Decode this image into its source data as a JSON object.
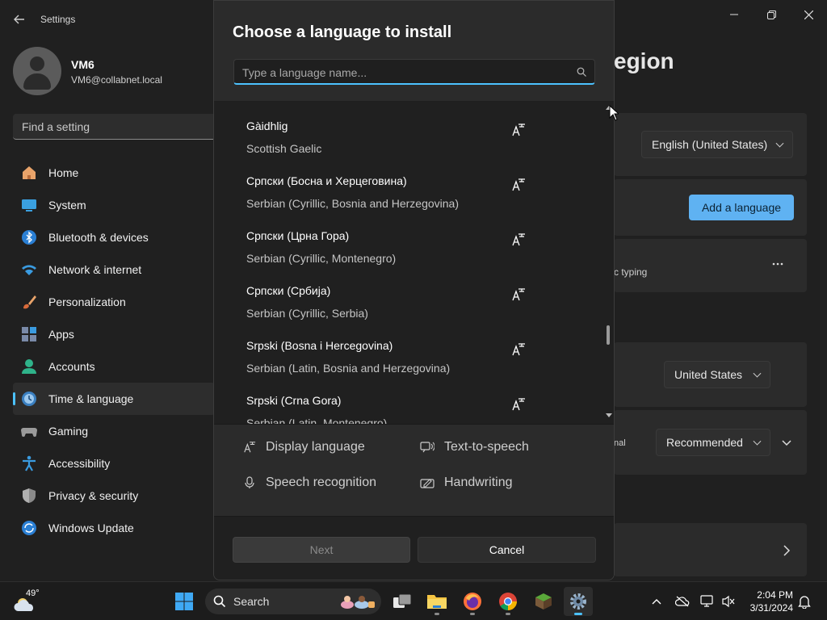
{
  "window": {
    "app_title": "Settings",
    "pane_title": "egion"
  },
  "profile": {
    "name": "VM6",
    "email": "VM6@collabnet.local"
  },
  "find_setting": {
    "placeholder": "Find a setting"
  },
  "sidebar": {
    "items": [
      {
        "label": "Home",
        "icon": "home-icon"
      },
      {
        "label": "System",
        "icon": "system-icon"
      },
      {
        "label": "Bluetooth & devices",
        "icon": "bluetooth-icon"
      },
      {
        "label": "Network & internet",
        "icon": "wifi-icon"
      },
      {
        "label": "Personalization",
        "icon": "brush-icon"
      },
      {
        "label": "Apps",
        "icon": "apps-icon"
      },
      {
        "label": "Accounts",
        "icon": "accounts-icon"
      },
      {
        "label": "Time & language",
        "icon": "clock-globe-icon",
        "active": true
      },
      {
        "label": "Gaming",
        "icon": "gamepad-icon"
      },
      {
        "label": "Accessibility",
        "icon": "accessibility-icon"
      },
      {
        "label": "Privacy & security",
        "icon": "shield-icon"
      },
      {
        "label": "Windows Update",
        "icon": "update-icon"
      }
    ]
  },
  "background": {
    "display_language_value": "English (United States)",
    "add_language_label": "Add a language",
    "typing_text": "c typing",
    "region_value": "United States",
    "regional_format_label": "nal",
    "regional_format_value": "Recommended"
  },
  "dialog": {
    "title": "Choose a language to install",
    "search_placeholder": "Type a language name...",
    "languages": [
      {
        "native": "Gàidhlig",
        "english": "Scottish Gaelic"
      },
      {
        "native": "Српски (Босна и Херцеговина)",
        "english": "Serbian (Cyrillic, Bosnia and Herzegovina)"
      },
      {
        "native": "Српски (Црна Гора)",
        "english": "Serbian (Cyrillic, Montenegro)"
      },
      {
        "native": "Српски (Србија)",
        "english": "Serbian (Cyrillic, Serbia)"
      },
      {
        "native": "Srpski (Bosna i Hercegovina)",
        "english": "Serbian (Latin, Bosnia and Herzegovina)"
      },
      {
        "native": "Srpski (Crna Gora)",
        "english": "Serbian (Latin, Montenegro)"
      }
    ],
    "legend": {
      "display_language": "Display language",
      "text_to_speech": "Text-to-speech",
      "speech_recognition": "Speech recognition",
      "handwriting": "Handwriting"
    },
    "next_label": "Next",
    "cancel_label": "Cancel"
  },
  "taskbar": {
    "weather_temp": "49°",
    "search_label": "Search",
    "time": "2:04 PM",
    "date": "3/31/2024"
  },
  "colors": {
    "accent": "#4cc2ff",
    "background": "#202020",
    "dialog": "#2b2b2b"
  }
}
